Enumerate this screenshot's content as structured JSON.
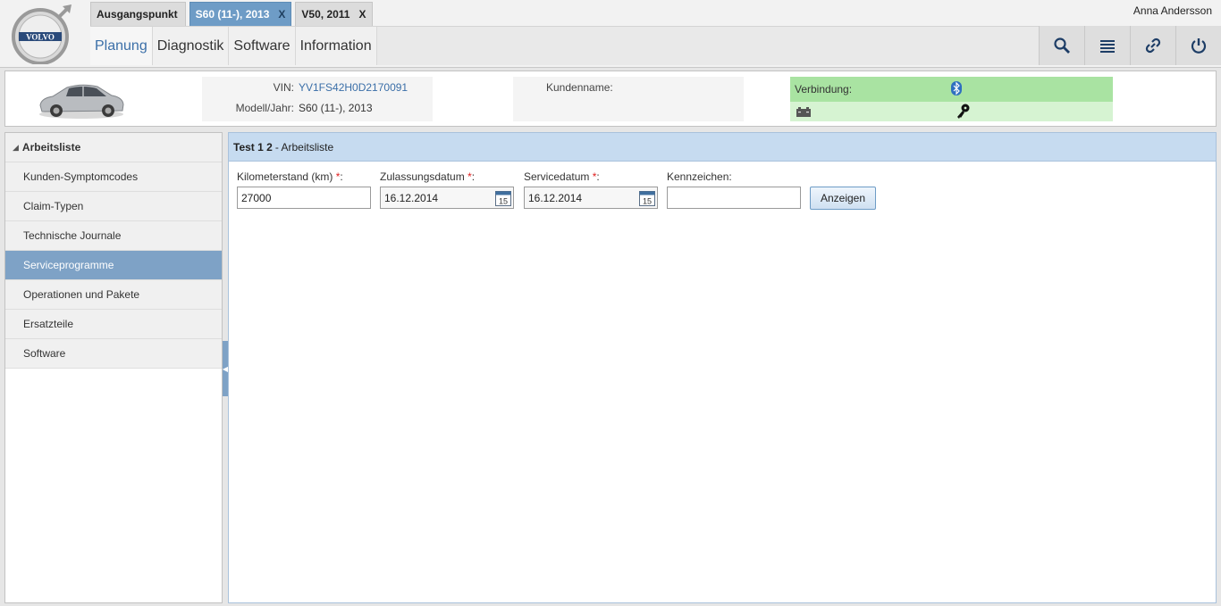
{
  "app": {
    "logo_text": "VOLVO",
    "user_name": "Anna Andersson"
  },
  "tabs": [
    {
      "label": "Ausgangspunkt",
      "closable": false,
      "active": false
    },
    {
      "label": "S60 (11-), 2013",
      "close": "X",
      "active": true
    },
    {
      "label": "V50, 2011",
      "close": "X",
      "active": false
    }
  ],
  "mainnav": [
    {
      "label": "Planung",
      "active": true
    },
    {
      "label": "Diagnostik"
    },
    {
      "label": "Software"
    },
    {
      "label": "Information"
    }
  ],
  "toolbar": {
    "icons": [
      "search-icon",
      "list-icon",
      "link-icon",
      "power-icon"
    ]
  },
  "vehicle": {
    "vin_label": "VIN:",
    "vin_value": "YV1FS42H0D2170091",
    "model_label": "Modell/Jahr:",
    "model_value": "S60 (11-), 2013",
    "customer_label": "Kundenname:",
    "customer_value": "",
    "connection_label": "Verbindung:"
  },
  "sidebar": {
    "header": "Arbeitsliste",
    "items": [
      {
        "label": "Kunden-Symptomcodes"
      },
      {
        "label": "Claim-Typen"
      },
      {
        "label": "Technische Journale"
      },
      {
        "label": "Serviceprogramme",
        "active": true
      },
      {
        "label": "Operationen und Pakete"
      },
      {
        "label": "Ersatzteile"
      },
      {
        "label": "Software"
      }
    ]
  },
  "content": {
    "title_bold": "Test 1 2",
    "title_rest": "- Arbeitsliste",
    "fields": {
      "km_label": "Kilometerstand (km)",
      "km_value": "27000",
      "reg_label": "Zulassungsdatum",
      "reg_value": "16.12.2014",
      "service_label": "Servicedatum",
      "service_value": "16.12.2014",
      "plate_label": "Kennzeichen:",
      "plate_value": "",
      "required_mark": "*",
      "colon": ":",
      "calendar_day": "15"
    },
    "show_button": "Anzeigen"
  },
  "colors": {
    "accent": "#6e9cc6",
    "link": "#3b6fa8",
    "connection_ok": "#a9e3a2",
    "required": "#e02020"
  }
}
